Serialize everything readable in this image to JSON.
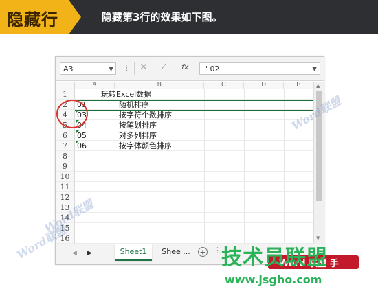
{
  "banner": {
    "tag": "隐藏行",
    "desc": "隐藏第3行的效果如下图。"
  },
  "formula_bar": {
    "name_box": "A3",
    "cancel_icon": "✕",
    "confirm_icon": "✓",
    "fx": "fx",
    "formula": "' 02"
  },
  "columns": [
    "A",
    "B",
    "C",
    "D",
    "E"
  ],
  "rows": [
    {
      "num": "1",
      "a": "",
      "b": "玩转Excel数据"
    },
    {
      "num": "2",
      "a": "01",
      "b": "随机排序"
    },
    {
      "num": "4",
      "a": "03",
      "b": "按字符个数排序"
    },
    {
      "num": "5",
      "a": "04",
      "b": "按笔划排序"
    },
    {
      "num": "6",
      "a": "05",
      "b": "对多列排序"
    },
    {
      "num": "7",
      "a": "06",
      "b": "按字体颜色排序"
    },
    {
      "num": "8",
      "a": "",
      "b": ""
    },
    {
      "num": "9",
      "a": "",
      "b": ""
    },
    {
      "num": "10",
      "a": "",
      "b": ""
    },
    {
      "num": "11",
      "a": "",
      "b": ""
    },
    {
      "num": "12",
      "a": "",
      "b": ""
    },
    {
      "num": "13",
      "a": "",
      "b": ""
    },
    {
      "num": "14",
      "a": "",
      "b": ""
    },
    {
      "num": "15",
      "a": "",
      "b": ""
    },
    {
      "num": "16",
      "a": "",
      "b": ""
    }
  ],
  "tabs": {
    "active": "Sheet1",
    "second": "Shee ...",
    "add": "+"
  },
  "watermarks": {
    "word1": "Word联盟",
    "word2": "Word联盟",
    "word3": "Word联盟",
    "brand": "技术员联盟",
    "badge": "Word 联盟 手",
    "url": "www.jsgho.com"
  },
  "colors": {
    "banner_bg": "#2d2f33",
    "banner_tag": "#f2b318",
    "excel_green": "#217346",
    "circle_red": "#d9342b",
    "brand_green": "#2bb35a"
  }
}
